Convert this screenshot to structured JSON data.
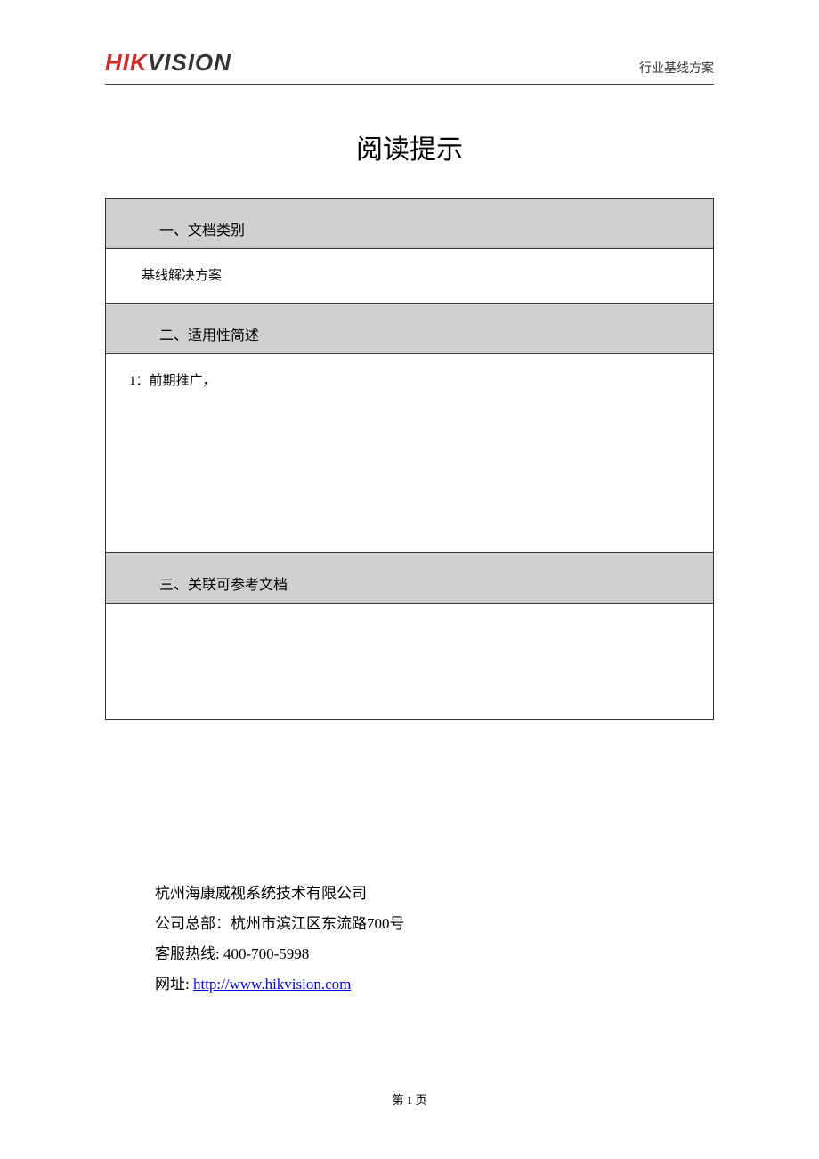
{
  "header": {
    "logo_hik": "HIK",
    "logo_vision": "VISION",
    "right_text": "行业基线方案"
  },
  "title": "阅读提示",
  "sections": [
    {
      "header": "一、文档类别",
      "content": "基线解决方案"
    },
    {
      "header": "二、适用性简述",
      "content": "1：前期推广，"
    },
    {
      "header": "三、关联可参考文档",
      "content": ""
    }
  ],
  "company": {
    "name": "杭州海康威视系统技术有限公司",
    "hq_label": "公司总部：",
    "hq_value": "杭州市滨江区东流路700号",
    "hotline_label": "客服热线: ",
    "hotline_value": "400-700-5998",
    "url_label": "网址: ",
    "url_value": "http://www.hikvision.com"
  },
  "page_number": "第 1 页"
}
